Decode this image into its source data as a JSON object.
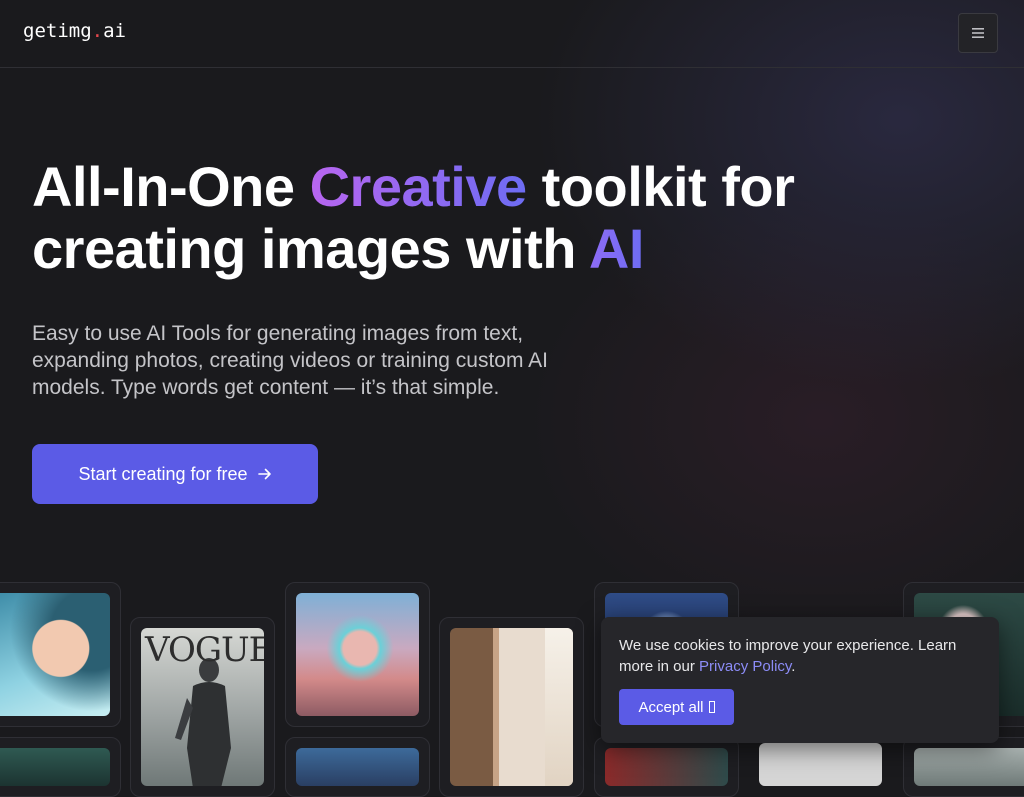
{
  "header": {
    "logo_main": "getimg",
    "logo_dot": ".",
    "logo_ext": "ai",
    "menu_icon": "hamburger-icon"
  },
  "hero": {
    "title_part1": "All-In-One ",
    "title_highlight1": "Creative",
    "title_part2": " toolkit for creating images with ",
    "title_highlight2": "AI",
    "subtitle": "Easy to use AI Tools for generating images from text, expanding photos, creating videos or training custom AI models. Type words get content — it’s that simple.",
    "cta_label": "Start creating for free",
    "cta_icon": "arrow-right-icon"
  },
  "gallery": {
    "vogue_text": "VOGUE"
  },
  "cookie": {
    "text_before": "We use cookies to improve your experience. Learn more in our ",
    "link": "Privacy Policy",
    "text_after": ".",
    "accept_label": "Accept all"
  },
  "colors": {
    "background": "#1a1a1d",
    "accent": "#5b5be6",
    "logo_dot": "#e5484d",
    "gradient_start": "#b866f0",
    "gradient_end": "#6d6cf3"
  }
}
